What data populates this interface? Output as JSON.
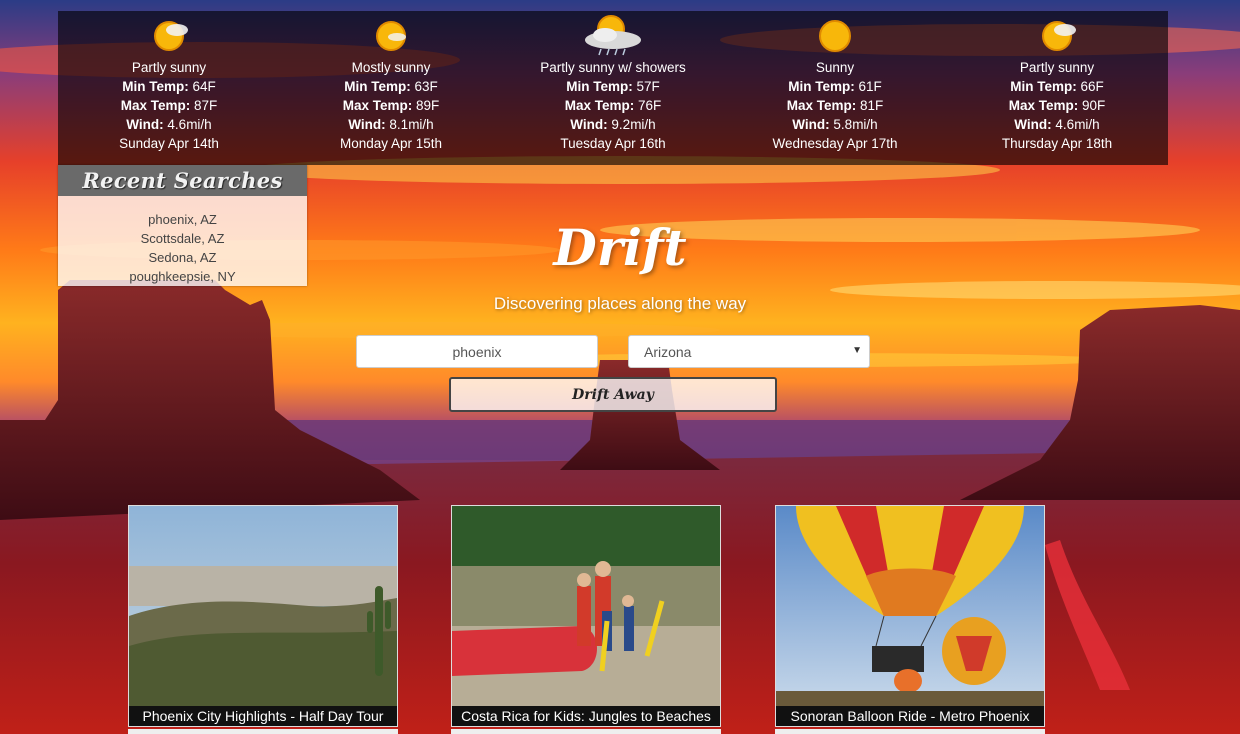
{
  "forecast": [
    {
      "condition": "Partly sunny",
      "min_label": "Min Temp:",
      "min": "64F",
      "max_label": "Max Temp:",
      "max": "87F",
      "wind_label": "Wind:",
      "wind": "4.6mi/h",
      "date": "Sunday Apr 14th",
      "icon": "partly-sunny-icon"
    },
    {
      "condition": "Mostly sunny",
      "min_label": "Min Temp:",
      "min": "63F",
      "max_label": "Max Temp:",
      "max": "89F",
      "wind_label": "Wind:",
      "wind": "8.1mi/h",
      "date": "Monday Apr 15th",
      "icon": "mostly-sunny-icon"
    },
    {
      "condition": "Partly sunny w/ showers",
      "min_label": "Min Temp:",
      "min": "57F",
      "max_label": "Max Temp:",
      "max": "76F",
      "wind_label": "Wind:",
      "wind": "9.2mi/h",
      "date": "Tuesday Apr 16th",
      "icon": "sun-showers-icon"
    },
    {
      "condition": "Sunny",
      "min_label": "Min Temp:",
      "min": "61F",
      "max_label": "Max Temp:",
      "max": "81F",
      "wind_label": "Wind:",
      "wind": "5.8mi/h",
      "date": "Wednesday Apr 17th",
      "icon": "sunny-icon"
    },
    {
      "condition": "Partly sunny",
      "min_label": "Min Temp:",
      "min": "66F",
      "max_label": "Max Temp:",
      "max": "90F",
      "wind_label": "Wind:",
      "wind": "4.6mi/h",
      "date": "Thursday Apr 18th",
      "icon": "partly-sunny-icon"
    }
  ],
  "recent": {
    "title": "Recent Searches",
    "items": [
      "phoenix, AZ",
      "Scottsdale, AZ",
      "Sedona, AZ",
      "poughkeepsie, NY"
    ]
  },
  "hero": {
    "brand": "Drift",
    "tagline": "Discovering places along the way"
  },
  "search": {
    "city_value": "phoenix",
    "state_value": "Arizona",
    "button_label": "Drift Away"
  },
  "tours": [
    {
      "title": "Phoenix City Highlights - Half Day Tour",
      "photo": "desert-cactus-photo"
    },
    {
      "title": "Costa Rica for Kids: Jungles to Beaches",
      "photo": "river-rafting-family-photo"
    },
    {
      "title": "Sonoran Balloon Ride - Metro Phoenix",
      "photo": "hot-air-balloon-photo"
    }
  ],
  "colors": {
    "overlay": "#000000",
    "recent_header": "#6a6a6a",
    "sky_top": "#2a3f8a",
    "sunset_orange": "#ff7a1a",
    "mesa_red": "#6a1420"
  }
}
